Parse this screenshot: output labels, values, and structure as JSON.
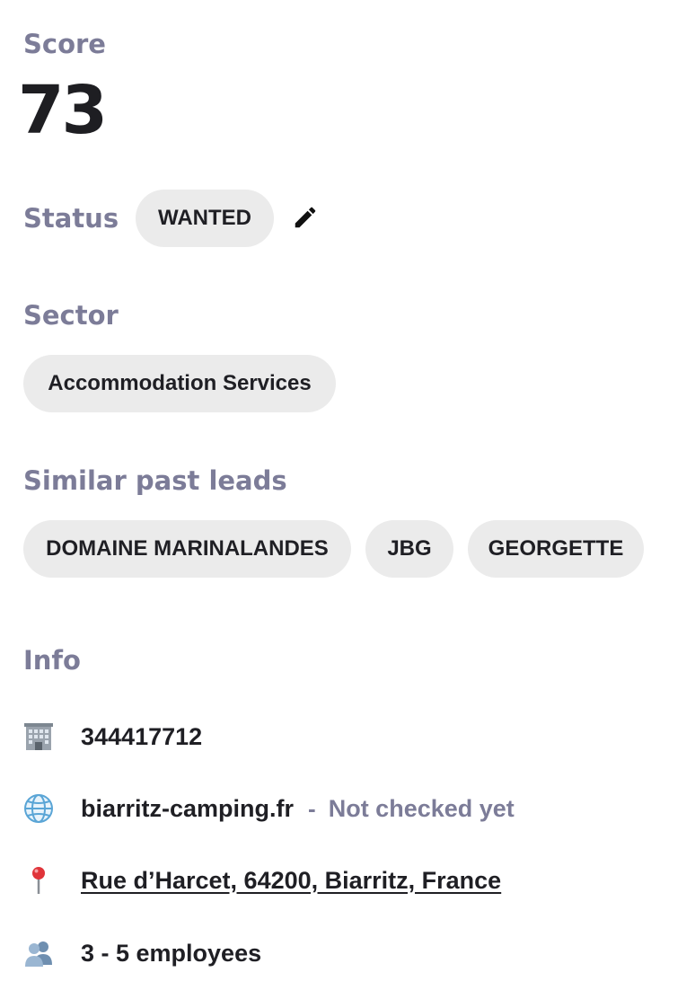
{
  "score": {
    "label": "Score",
    "value": "73"
  },
  "status": {
    "label": "Status",
    "value": "WANTED",
    "edit_icon": "pencil-icon"
  },
  "sector": {
    "label": "Sector",
    "value": "Accommodation Services"
  },
  "similar_past_leads": {
    "label": "Similar past leads",
    "items": [
      "DOMAINE MARINALANDES",
      "JBG",
      "GEORGETTE"
    ]
  },
  "info": {
    "label": "Info",
    "company_id": {
      "icon": "building-icon",
      "value": "344417712"
    },
    "website": {
      "icon": "globe-icon",
      "value": "biarritz-camping.fr",
      "separator": "-",
      "check_status": "Not checked yet"
    },
    "address": {
      "icon": "map-pin-icon",
      "value": "Rue d’Harcet, 64200, Biarritz, France"
    },
    "employees": {
      "icon": "people-icon",
      "value": "3 - 5 employees"
    }
  },
  "colors": {
    "label": "#7c7c98",
    "chip_bg": "#ebebeb",
    "text": "#1f1f24"
  }
}
